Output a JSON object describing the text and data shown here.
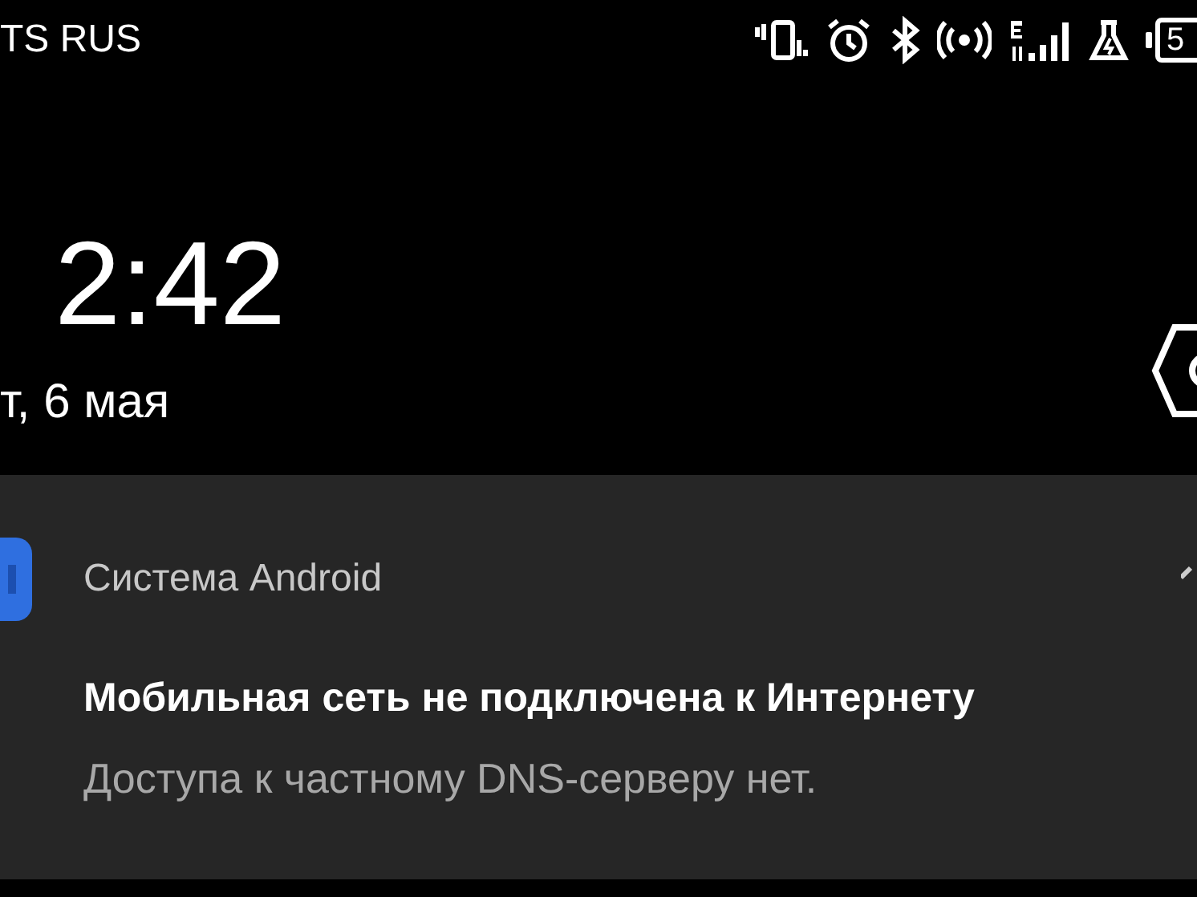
{
  "status_bar": {
    "carrier": "TS RUS",
    "battery_text": "5"
  },
  "lock_screen": {
    "time": "2:42",
    "date": "т, 6 мая"
  },
  "notification": {
    "app": "Система Android",
    "title": "Мобильная сеть не подключена к Интернету",
    "body": "Доступа к частному DNS-серверу нет."
  }
}
